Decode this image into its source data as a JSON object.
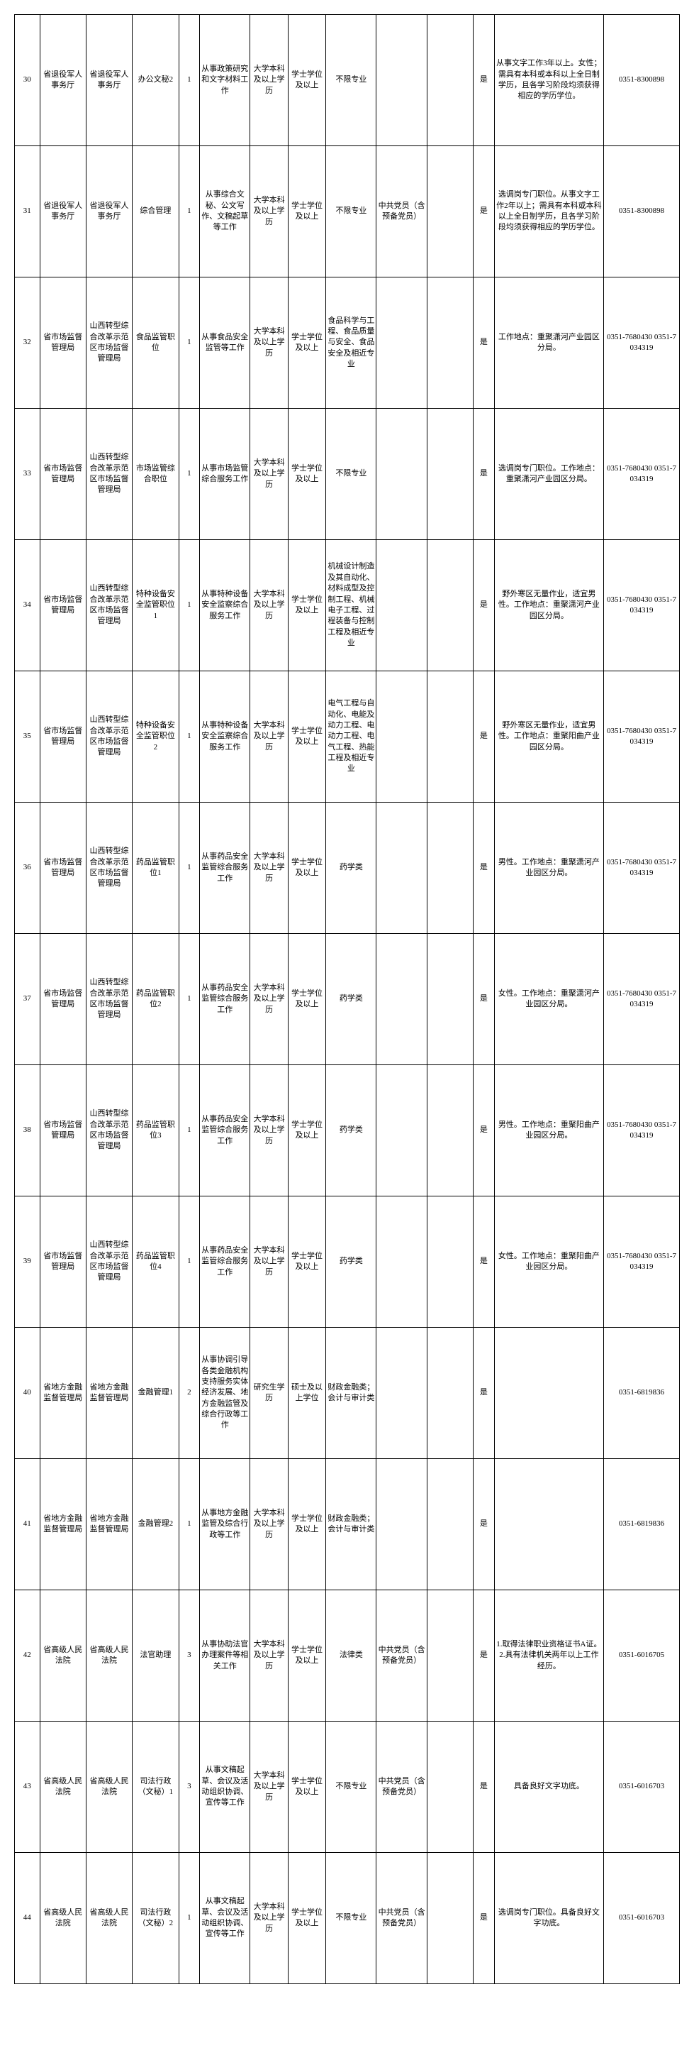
{
  "rows": [
    {
      "no": "30",
      "dept1": "省退役军人事务厅",
      "dept2": "省退役军人事务厅",
      "post": "办公文秘2",
      "num": "1",
      "duty": "从事政策研究和文字材料工作",
      "edu": "大学本科及以上学历",
      "degree": "学士学位及以上",
      "major": "不限专业",
      "politics": "",
      "other": "",
      "shi": "是",
      "remark": "从事文字工作3年以上。女性；需具有本科或本科以上全日制学历，且各学习阶段均须获得相应的学历学位。",
      "phone": "0351-8300898"
    },
    {
      "no": "31",
      "dept1": "省退役军人事务厅",
      "dept2": "省退役军人事务厅",
      "post": "综合管理",
      "num": "1",
      "duty": "从事综合文秘、公文写作、文稿起草等工作",
      "edu": "大学本科及以上学历",
      "degree": "学士学位及以上",
      "major": "不限专业",
      "politics": "中共党员（含预备党员）",
      "other": "",
      "shi": "是",
      "remark": "选调岗专门职位。从事文字工作2年以上；需具有本科或本科以上全日制学历，且各学习阶段均须获得相应的学历学位。",
      "phone": "0351-8300898"
    },
    {
      "no": "32",
      "dept1": "省市场监督管理局",
      "dept2": "山西转型综合改革示范区市场监督管理局",
      "post": "食品监管职位",
      "num": "1",
      "duty": "从事食品安全监管等工作",
      "edu": "大学本科及以上学历",
      "degree": "学士学位及以上",
      "major": "食品科学与工程、食品质量与安全、食品安全及相近专业",
      "politics": "",
      "other": "",
      "shi": "是",
      "remark": "工作地点：重聚潇河产业园区分局。",
      "phone": "0351-7680430 0351-7034319"
    },
    {
      "no": "33",
      "dept1": "省市场监督管理局",
      "dept2": "山西转型综合改革示范区市场监督管理局",
      "post": "市场监管综合职位",
      "num": "1",
      "duty": "从事市场监管综合服务工作",
      "edu": "大学本科及以上学历",
      "degree": "学士学位及以上",
      "major": "不限专业",
      "politics": "",
      "other": "",
      "shi": "是",
      "remark": "选调岗专门职位。工作地点：重聚潇河产业园区分局。",
      "phone": "0351-7680430 0351-7034319"
    },
    {
      "no": "34",
      "dept1": "省市场监督管理局",
      "dept2": "山西转型综合改革示范区市场监督管理局",
      "post": "特种设备安全监管职位1",
      "num": "1",
      "duty": "从事特种设备安全监察综合服务工作",
      "edu": "大学本科及以上学历",
      "degree": "学士学位及以上",
      "major": "机械设计制造及其自动化、材料成型及控制工程、机械电子工程、过程装备与控制工程及相近专业",
      "politics": "",
      "other": "",
      "shi": "是",
      "remark": "野外寒区无量作业，适宜男性。工作地点：重聚潇河产业园区分局。",
      "phone": "0351-7680430 0351-7034319"
    },
    {
      "no": "35",
      "dept1": "省市场监督管理局",
      "dept2": "山西转型综合改革示范区市场监督管理局",
      "post": "特种设备安全监管职位2",
      "num": "1",
      "duty": "从事特种设备安全监察综合服务工作",
      "edu": "大学本科及以上学历",
      "degree": "学士学位及以上",
      "major": "电气工程与自动化、电能及动力工程、电动力工程、电气工程、热能工程及相近专业",
      "politics": "",
      "other": "",
      "shi": "是",
      "remark": "野外寒区无量作业，适宜男性。工作地点：重聚阳曲产业园区分局。",
      "phone": "0351-7680430 0351-7034319"
    },
    {
      "no": "36",
      "dept1": "省市场监督管理局",
      "dept2": "山西转型综合改革示范区市场监督管理局",
      "post": "药品监管职位1",
      "num": "1",
      "duty": "从事药品安全监管综合服务工作",
      "edu": "大学本科及以上学历",
      "degree": "学士学位及以上",
      "major": "药学类",
      "politics": "",
      "other": "",
      "shi": "是",
      "remark": "男性。工作地点：重聚潇河产业园区分局。",
      "phone": "0351-7680430 0351-7034319"
    },
    {
      "no": "37",
      "dept1": "省市场监督管理局",
      "dept2": "山西转型综合改革示范区市场监督管理局",
      "post": "药品监管职位2",
      "num": "1",
      "duty": "从事药品安全监管综合服务工作",
      "edu": "大学本科及以上学历",
      "degree": "学士学位及以上",
      "major": "药学类",
      "politics": "",
      "other": "",
      "shi": "是",
      "remark": "女性。工作地点：重聚潇河产业园区分局。",
      "phone": "0351-7680430 0351-7034319"
    },
    {
      "no": "38",
      "dept1": "省市场监督管理局",
      "dept2": "山西转型综合改革示范区市场监督管理局",
      "post": "药品监管职位3",
      "num": "1",
      "duty": "从事药品安全监管综合服务工作",
      "edu": "大学本科及以上学历",
      "degree": "学士学位及以上",
      "major": "药学类",
      "politics": "",
      "other": "",
      "shi": "是",
      "remark": "男性。工作地点：重聚阳曲产业园区分局。",
      "phone": "0351-7680430 0351-7034319"
    },
    {
      "no": "39",
      "dept1": "省市场监督管理局",
      "dept2": "山西转型综合改革示范区市场监督管理局",
      "post": "药品监管职位4",
      "num": "1",
      "duty": "从事药品安全监管综合服务工作",
      "edu": "大学本科及以上学历",
      "degree": "学士学位及以上",
      "major": "药学类",
      "politics": "",
      "other": "",
      "shi": "是",
      "remark": "女性。工作地点：重聚阳曲产业园区分局。",
      "phone": "0351-7680430 0351-7034319"
    },
    {
      "no": "40",
      "dept1": "省地方金融监督管理局",
      "dept2": "省地方金融监督管理局",
      "post": "金融管理1",
      "num": "2",
      "duty": "从事协调引导各类金融机构支持服务实体经济发展、地方金融监管及综合行政等工作",
      "edu": "研究生学历",
      "degree": "硕士及以上学位",
      "major": "财政金融类；会计与审计类",
      "politics": "",
      "other": "",
      "shi": "是",
      "remark": "",
      "phone": "0351-6819836"
    },
    {
      "no": "41",
      "dept1": "省地方金融监督管理局",
      "dept2": "省地方金融监督管理局",
      "post": "金融管理2",
      "num": "1",
      "duty": "从事地方金融监管及综合行政等工作",
      "edu": "大学本科及以上学历",
      "degree": "学士学位及以上",
      "major": "财政金融类；会计与审计类",
      "politics": "",
      "other": "",
      "shi": "是",
      "remark": "",
      "phone": "0351-6819836"
    },
    {
      "no": "42",
      "dept1": "省高级人民法院",
      "dept2": "省高级人民法院",
      "post": "法官助理",
      "num": "3",
      "duty": "从事协助法官办理案件等相关工作",
      "edu": "大学本科及以上学历",
      "degree": "学士学位及以上",
      "major": "法律类",
      "politics": "中共党员（含预备党员）",
      "other": "",
      "shi": "是",
      "remark": "1.取得法律职业资格证书A证。2.具有法律机关两年以上工作经历。",
      "phone": "0351-6016705"
    },
    {
      "no": "43",
      "dept1": "省高级人民法院",
      "dept2": "省高级人民法院",
      "post": "司法行政（文秘）1",
      "num": "3",
      "duty": "从事文稿起草、会议及活动组织协调、宣传等工作",
      "edu": "大学本科及以上学历",
      "degree": "学士学位及以上",
      "major": "不限专业",
      "politics": "中共党员（含预备党员）",
      "other": "",
      "shi": "是",
      "remark": "具备良好文字功底。",
      "phone": "0351-6016703"
    },
    {
      "no": "44",
      "dept1": "省高级人民法院",
      "dept2": "省高级人民法院",
      "post": "司法行政（文秘）2",
      "num": "1",
      "duty": "从事文稿起草、会议及活动组织协调、宣传等工作",
      "edu": "大学本科及以上学历",
      "degree": "学士学位及以上",
      "major": "不限专业",
      "politics": "中共党员（含预备党员）",
      "other": "",
      "shi": "是",
      "remark": "选调岗专门职位。具备良好文字功底。",
      "phone": "0351-6016703"
    }
  ]
}
